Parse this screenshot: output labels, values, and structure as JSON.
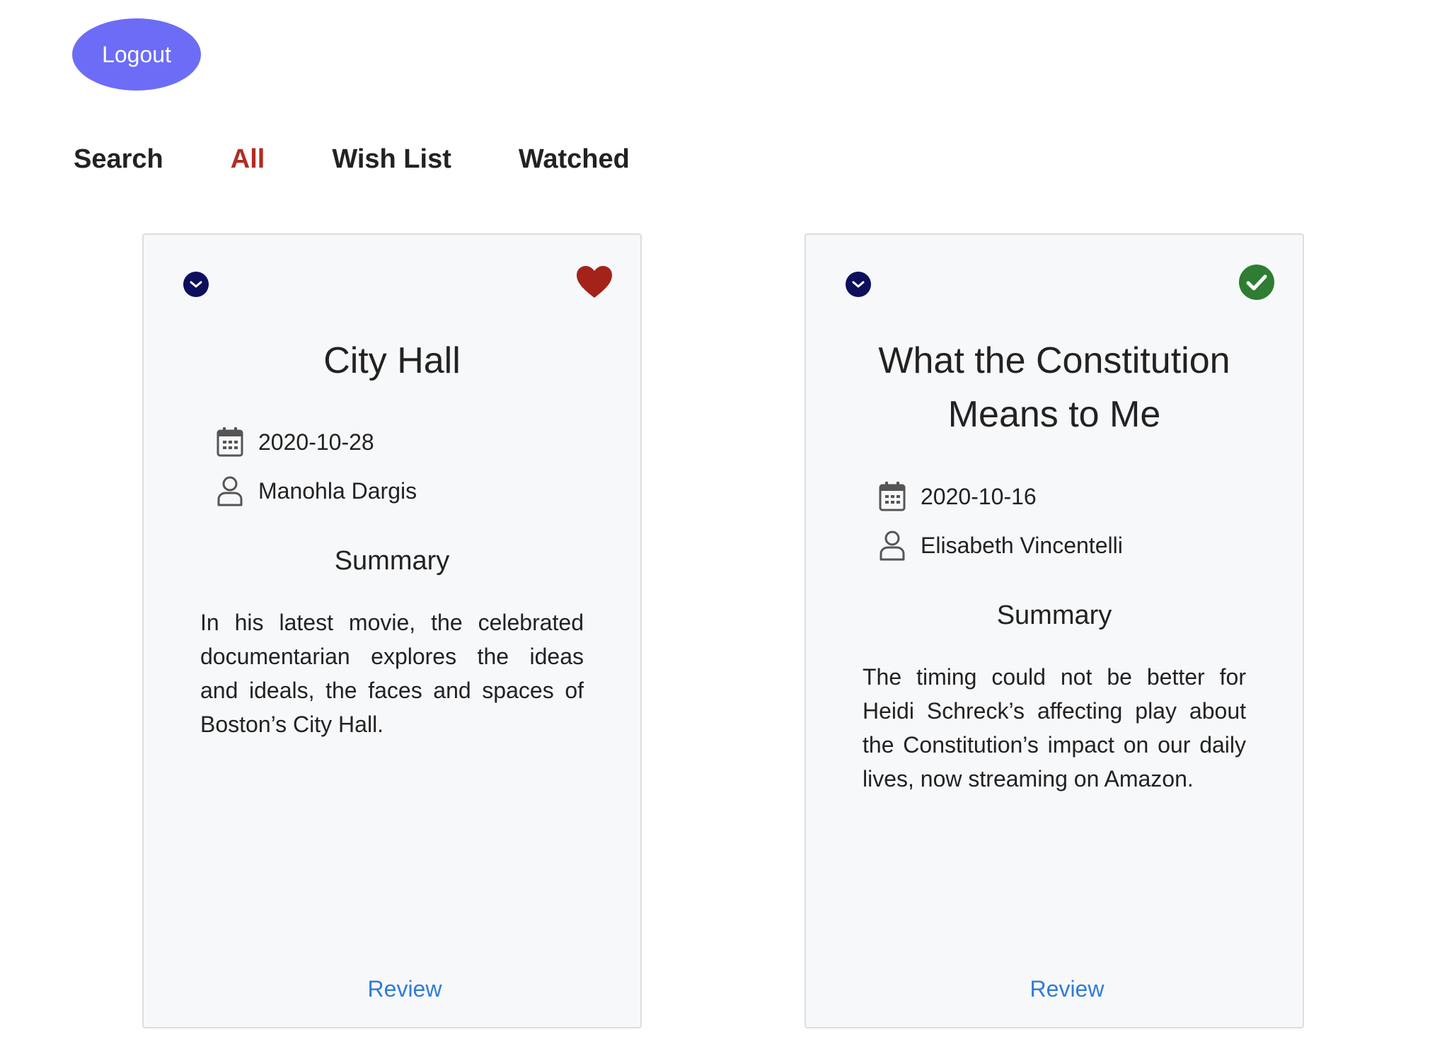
{
  "header": {
    "logout_label": "Logout"
  },
  "tabs": [
    {
      "label": "Search",
      "active": false
    },
    {
      "label": "All",
      "active": true
    },
    {
      "label": "Wish List",
      "active": false
    },
    {
      "label": "Watched",
      "active": false
    }
  ],
  "colors": {
    "accent": "#6c6cf7",
    "active_tab": "#b12d22",
    "heart": "#a3231a",
    "check": "#2e7d32",
    "expand": "#0e0f5c",
    "link": "#2f7bd9"
  },
  "cards": [
    {
      "title": "City Hall",
      "status_icon": "heart-icon",
      "date": "2020-10-28",
      "author": "Manohla Dargis",
      "summary_heading": "Summary",
      "summary": "In his latest movie, the celebrated documentarian explores the ideas and ideals, the faces and spaces of Boston’s City Hall.",
      "review_label": "Review"
    },
    {
      "title": "What the Constitution Means to Me",
      "status_icon": "check-circle-icon",
      "date": "2020-10-16",
      "author": "Elisabeth Vincentelli",
      "summary_heading": "Summary",
      "summary": "The timing could not be better for Heidi Schreck’s affecting play about the Constitution’s impact on our daily lives, now streaming on Amazon.",
      "review_label": "Review"
    }
  ]
}
